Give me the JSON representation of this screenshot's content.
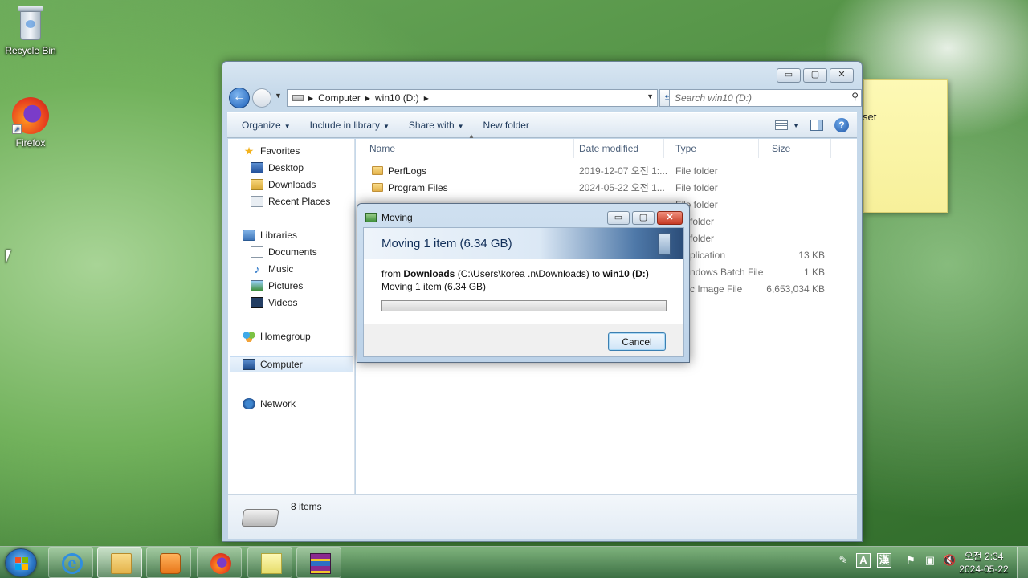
{
  "desktop": {
    "recycle_bin": "Recycle Bin",
    "firefox": "Firefox",
    "sticky_note_text": "set"
  },
  "explorer": {
    "title_buttons": {
      "minimize": "▭",
      "maximize": "▢",
      "close": "✕"
    },
    "breadcrumb": [
      "Computer",
      "win10 (D:)"
    ],
    "search_placeholder": "Search win10 (D:)",
    "toolbar": {
      "organize": "Organize",
      "include_in_library": "Include in library",
      "share_with": "Share with",
      "new_folder": "New folder"
    },
    "nav": {
      "favorites": "Favorites",
      "desktop": "Desktop",
      "downloads": "Downloads",
      "recent_places": "Recent Places",
      "libraries": "Libraries",
      "documents": "Documents",
      "music": "Music",
      "pictures": "Pictures",
      "videos": "Videos",
      "homegroup": "Homegroup",
      "computer": "Computer",
      "network": "Network"
    },
    "columns": {
      "name": "Name",
      "date": "Date modified",
      "type": "Type",
      "size": "Size"
    },
    "files": [
      {
        "name": "PerfLogs",
        "date": "2019-12-07 오전 1:...",
        "type": "File folder",
        "size": ""
      },
      {
        "name": "Program Files",
        "date": "2024-05-22 오전 1...",
        "type": "File folder",
        "size": ""
      },
      {
        "name": "",
        "date": "",
        "type": "File folder",
        "size": ""
      },
      {
        "name": "",
        "date": "",
        "type": "folder",
        "size": ""
      },
      {
        "name": "",
        "date": "",
        "type": "folder",
        "size": ""
      },
      {
        "name": "",
        "date": "",
        "type": "plication",
        "size": "13 KB"
      },
      {
        "name": "",
        "date": "",
        "type": "ndows Batch File",
        "size": "1 KB"
      },
      {
        "name": "",
        "date": "",
        "type": "c Image File",
        "size": "6,653,034 KB"
      }
    ],
    "item_count": "8 items"
  },
  "dialog": {
    "title": "Moving",
    "heading": "Moving 1 item (6.34 GB)",
    "from_prefix": "from ",
    "from_source": "Downloads",
    "from_path": " (C:\\Users\\korea .n\\Downloads) to ",
    "to_dest": "win10 (D:)",
    "subtext": "Moving 1 item (6.34 GB)",
    "progress": 0,
    "cancel": "Cancel"
  },
  "taskbar": {
    "ime_a": "A",
    "ime_han": "漢",
    "time": "오전 2:34",
    "date": "2024-05-22"
  }
}
